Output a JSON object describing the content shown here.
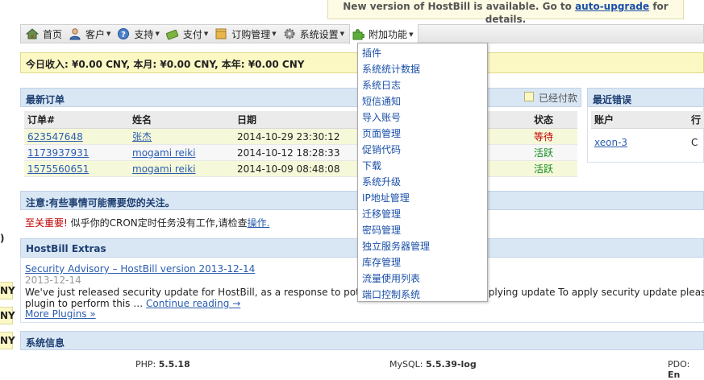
{
  "notice": {
    "text_before": "New version of HostBill is available. Go to ",
    "link": "auto-upgrade",
    "text_after": " for details."
  },
  "left_fragments": [
    ")",
    "NY",
    "NY",
    "NY"
  ],
  "nav": {
    "items": [
      {
        "label": "首页",
        "icon": "home-icon",
        "caret": false
      },
      {
        "label": "客户",
        "icon": "user-icon",
        "caret": true
      },
      {
        "label": "支持",
        "icon": "help-icon",
        "caret": true
      },
      {
        "label": "支付",
        "icon": "payment-icon",
        "caret": true
      },
      {
        "label": "订购管理",
        "icon": "box-icon",
        "caret": true
      },
      {
        "label": "系统设置",
        "icon": "gear-icon",
        "caret": true
      },
      {
        "label": "附加功能",
        "icon": "puzzle-icon",
        "caret": true
      }
    ],
    "caret_glyph": "▼"
  },
  "income": {
    "text": "今日收入: ¥0.00 CNY, 本月: ¥0.00 CNY, 本年: ¥0.00 CNY"
  },
  "orders": {
    "title": "最新订单",
    "paid_label": "已经付款",
    "columns": [
      "订单#",
      "姓名",
      "日期",
      "状态"
    ],
    "rows": [
      {
        "id": "623547648",
        "name": "张杰",
        "date": "2014-10-29 23:30:12",
        "status": "等待"
      },
      {
        "id": "1173937931",
        "name": "mogami reiki",
        "date": "2014-10-12 18:28:33",
        "status": "活跃"
      },
      {
        "id": "1575560651",
        "name": "mogami reiki",
        "date": "2014-10-09 08:48:08",
        "status": "活跃"
      }
    ]
  },
  "errors": {
    "title": "最近错误",
    "columns": [
      "账户",
      "行"
    ],
    "rows": [
      {
        "account": "xeon-3",
        "value": "C"
      }
    ]
  },
  "warning": {
    "title": "注意:有些事情可能需要您的关注。",
    "important": "至关重要!",
    "text": " 似乎你的CRON定时任务没有工作,请检查",
    "link": "操作."
  },
  "extras": {
    "title": "HostBill Extras",
    "post_title": "Security Advisory – HostBill version 2013-12-14",
    "post_date": "2013-12-14",
    "body_line1": "We've just released security update for HostBill, as a response to potentially",
    "body_line1_tail": "Applying update To apply security update please",
    "body_line2": "plugin to perform this … ",
    "continue": "Continue reading →",
    "more": "More Plugins »"
  },
  "sysinfo": {
    "title": "系统信息",
    "php_label": "PHP:",
    "php_value": "5.5.18",
    "mysql_label": "MySQL:",
    "mysql_value": "5.5.39-log",
    "pdo_label": "PDO:",
    "pdo_value": "En"
  },
  "dropdown": {
    "items": [
      "插件",
      "系统统计数据",
      "系统日志",
      "短信通知",
      "导入账号",
      "页面管理",
      "促销代码",
      "下载",
      "系统升级",
      "IP地址管理",
      "迁移管理",
      "密码管理",
      "独立服务器管理",
      "库存管理",
      "流量使用列表",
      "端口控制系统"
    ]
  },
  "colors": {
    "panel_header": "#d9e6f4",
    "panel_title": "#1d3f72",
    "income_bg": "#fbf8c4",
    "link": "#2a5db0",
    "status_wait": "#c00000",
    "status_active": "#138a1e"
  }
}
